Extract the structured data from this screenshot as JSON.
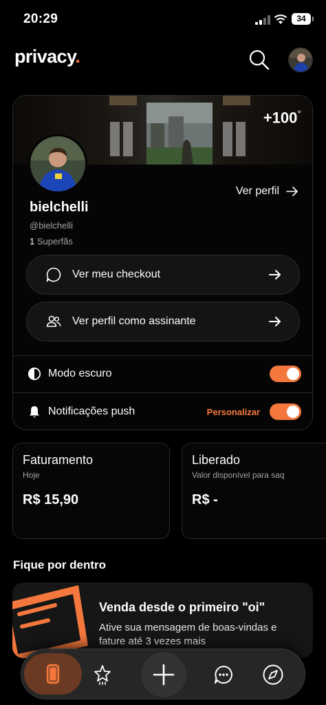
{
  "status_bar": {
    "time": "20:29",
    "battery": "34"
  },
  "header": {
    "logo_text": "privacy",
    "logo_dot": ".",
    "accent_color": "#f4783d",
    "search_icon": "search-icon"
  },
  "profile": {
    "superfans_badge": "+100",
    "superfans_badge_sup": "°",
    "view_profile_label": "Ver perfil",
    "username": "bielchelli",
    "handle": "@bielchelli",
    "superfans_count": "1",
    "superfans_label": "Superfãs",
    "actions": [
      {
        "label": "Ver meu checkout",
        "icon": "chat-bubble-icon"
      },
      {
        "label": "Ver perfil como assinante",
        "icon": "users-icon"
      }
    ],
    "settings": [
      {
        "label": "Modo escuro",
        "icon": "contrast-icon",
        "enabled": true
      },
      {
        "label": "Notificações push",
        "icon": "bell-icon",
        "extra": "Personalizar",
        "enabled": true
      }
    ]
  },
  "stats": [
    {
      "title": "Faturamento",
      "subtitle": "Hoje",
      "value": "R$ 15,90"
    },
    {
      "title": "Liberado",
      "subtitle": "Valor disponível para saq",
      "value": "R$ -"
    }
  ],
  "news": {
    "section_title": "Fique por dentro",
    "promo_title": "Venda desde o primeiro \"oi\"",
    "promo_description": "Ative sua mensagem de boas-vindas e fature até 3 vezes mais"
  },
  "bottom_nav": [
    {
      "name": "home",
      "icon": "phone-icon",
      "active": true
    },
    {
      "name": "favorites",
      "icon": "star-icon"
    },
    {
      "name": "add",
      "icon": "plus-icon"
    },
    {
      "name": "messages",
      "icon": "chat-icon"
    },
    {
      "name": "explore",
      "icon": "compass-icon"
    }
  ],
  "below_nav_text": "· · ·"
}
